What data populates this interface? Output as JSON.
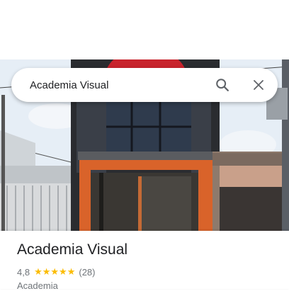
{
  "search": {
    "value": "Academia Visual"
  },
  "place": {
    "name": "Academia Visual",
    "rating": "4,8",
    "stars": "★★★★★",
    "reviews": "(28)",
    "category": "Academia"
  },
  "icons": {
    "search": "search-icon",
    "close": "close-icon"
  },
  "colors": {
    "star": "#fbbc04",
    "text_primary": "#202124",
    "text_secondary": "#70757a",
    "facade_orange": "#d9632a",
    "sign_red": "#c8232c"
  }
}
